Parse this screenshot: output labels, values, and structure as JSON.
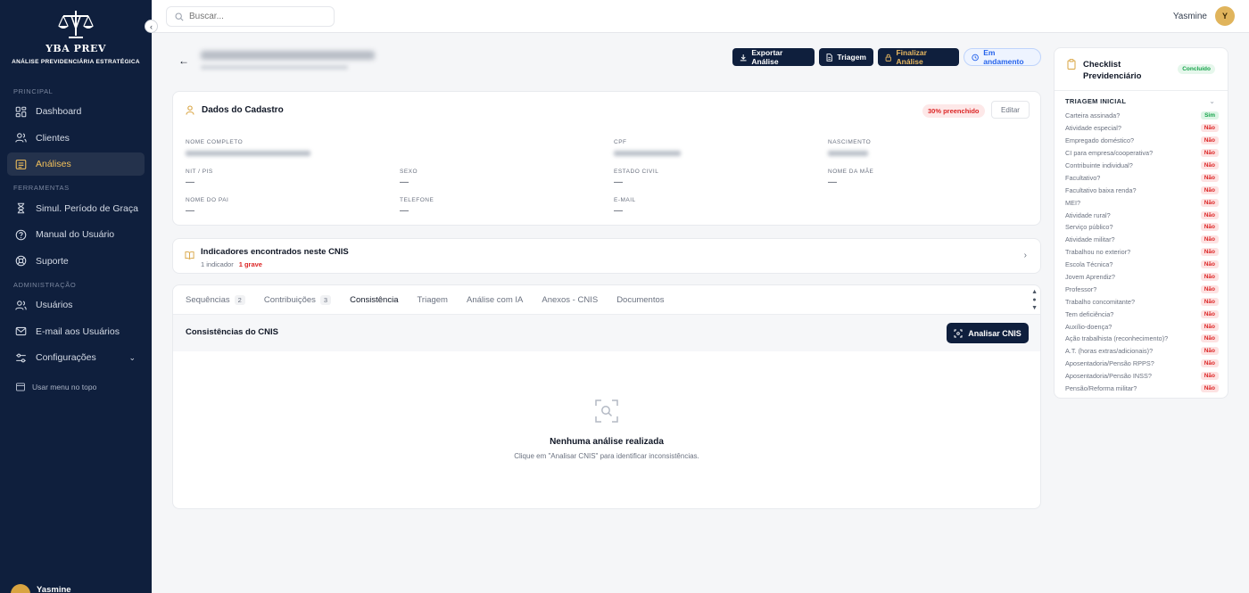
{
  "brand": {
    "name": "YBA PREV",
    "tagline": "ANÁLISE PREVIDENCIÁRIA ESTRATÉGICA"
  },
  "sidebar": {
    "sections": [
      {
        "label": "PRINCIPAL",
        "items": [
          {
            "label": "Dashboard",
            "icon": "dashboard-icon",
            "active": false
          },
          {
            "label": "Clientes",
            "icon": "users-icon",
            "active": false
          },
          {
            "label": "Análises",
            "icon": "file-icon",
            "active": true
          }
        ]
      },
      {
        "label": "FERRAMENTAS",
        "items": [
          {
            "label": "Simul. Período de Graça",
            "icon": "hourglass-icon",
            "active": false
          },
          {
            "label": "Manual do Usuário",
            "icon": "help-icon",
            "active": false
          },
          {
            "label": "Suporte",
            "icon": "support-icon",
            "active": false
          }
        ]
      },
      {
        "label": "ADMINISTRAÇÃO",
        "items": [
          {
            "label": "Usuários",
            "icon": "users-icon",
            "active": false
          },
          {
            "label": "E-mail aos Usuários",
            "icon": "mail-icon",
            "active": false
          },
          {
            "label": "Configurações",
            "icon": "settings-icon",
            "active": false
          }
        ]
      }
    ],
    "menu_top_label": "Usar menu no topo",
    "user_name": "Yasmine"
  },
  "topbar": {
    "search_placeholder": "Buscar...",
    "user_name": "Yasmine",
    "avatar_initial": "Y"
  },
  "header": {
    "buttons": {
      "export": "Exportar Análise",
      "triagem": "Triagem",
      "finalize": "Finalizar Análise",
      "status": "Em andamento"
    }
  },
  "cadastro": {
    "title": "Dados do Cadastro",
    "fill_badge": "30% preenchido",
    "edit_label": "Editar",
    "fields": {
      "nome_completo": {
        "label": "NOME COMPLETO"
      },
      "cpf": {
        "label": "CPF"
      },
      "nascimento": {
        "label": "NASCIMENTO"
      },
      "nit": {
        "label": "NIT / PIS",
        "value": "—"
      },
      "sexo": {
        "label": "SEXO",
        "value": "—"
      },
      "estado_civil": {
        "label": "ESTADO CIVIL",
        "value": "—"
      },
      "nome_mae": {
        "label": "NOME DA MÃE",
        "value": "—"
      },
      "nome_pai": {
        "label": "NOME DO PAI",
        "value": "—"
      },
      "telefone": {
        "label": "TELEFONE",
        "value": "—"
      },
      "email": {
        "label": "E-MAIL",
        "value": "—"
      }
    }
  },
  "indicators": {
    "title": "Indicadores encontrados neste CNIS",
    "count_text": "1 indicador",
    "severity_text": "1 grave"
  },
  "tabs": [
    {
      "label": "Sequências",
      "count": "2",
      "active": false
    },
    {
      "label": "Contribuições",
      "count": "3",
      "active": false
    },
    {
      "label": "Consistência",
      "count": "",
      "active": true
    },
    {
      "label": "Triagem",
      "count": "",
      "active": false
    },
    {
      "label": "Análise com IA",
      "count": "",
      "active": false
    },
    {
      "label": "Anexos - CNIS",
      "count": "",
      "active": false
    },
    {
      "label": "Documentos",
      "count": "",
      "active": false
    }
  ],
  "consistency": {
    "title": "Consistências do CNIS",
    "analyze_label": "Analisar CNIS",
    "empty_title": "Nenhuma análise realizada",
    "empty_subtitle": "Clique em \"Analisar CNIS\" para identificar inconsistências."
  },
  "checklist": {
    "title_line1": "Checklist",
    "title_line2": "Previdenciário",
    "status": "Concluído",
    "section": "TRIAGEM INICIAL",
    "items": [
      {
        "q": "Carteira assinada?",
        "a": "Sim"
      },
      {
        "q": "Atividade especial?",
        "a": "Não"
      },
      {
        "q": "Empregado doméstico?",
        "a": "Não"
      },
      {
        "q": "CI para empresa/cooperativa?",
        "a": "Não"
      },
      {
        "q": "Contribuinte individual?",
        "a": "Não"
      },
      {
        "q": "Facultativo?",
        "a": "Não"
      },
      {
        "q": "Facultativo baixa renda?",
        "a": "Não"
      },
      {
        "q": "MEI?",
        "a": "Não"
      },
      {
        "q": "Atividade rural?",
        "a": "Não"
      },
      {
        "q": "Serviço público?",
        "a": "Não"
      },
      {
        "q": "Atividade militar?",
        "a": "Não"
      },
      {
        "q": "Trabalhou no exterior?",
        "a": "Não"
      },
      {
        "q": "Escola Técnica?",
        "a": "Não"
      },
      {
        "q": "Jovem Aprendiz?",
        "a": "Não"
      },
      {
        "q": "Professor?",
        "a": "Não"
      },
      {
        "q": "Trabalho concomitante?",
        "a": "Não"
      },
      {
        "q": "Tem deficiência?",
        "a": "Não"
      },
      {
        "q": "Auxílio-doença?",
        "a": "Não"
      },
      {
        "q": "Ação trabalhista (reconhecimento)?",
        "a": "Não"
      },
      {
        "q": "A.T. (horas extras/adicionais)?",
        "a": "Não"
      },
      {
        "q": "Aposentadoria/Pensão RPPS?",
        "a": "Não"
      },
      {
        "q": "Aposentadoria/Pensão INSS?",
        "a": "Não"
      },
      {
        "q": "Pensão/Reforma militar?",
        "a": "Não"
      }
    ]
  }
}
